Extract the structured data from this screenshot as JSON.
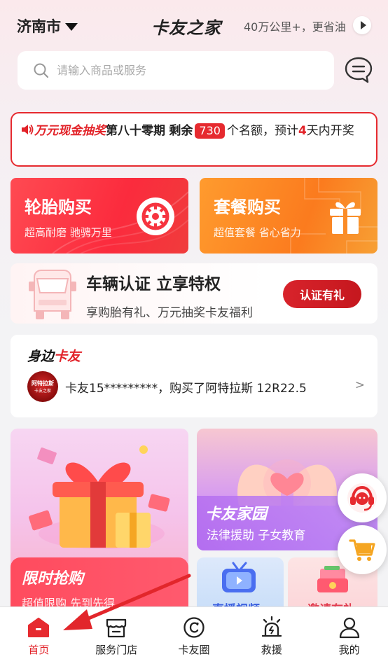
{
  "header": {
    "city": "济南市",
    "brand": "卡友之家",
    "slogan": "40万公里+，更省油"
  },
  "search": {
    "placeholder": "请输入商品或服务"
  },
  "notice": {
    "lottery_title": "万元现金抽奖",
    "period": "第八十零期",
    "remaining_label": "剩余",
    "count": "730",
    "text_mid": "个名额，预计",
    "days": "4",
    "text_end": "天内开奖"
  },
  "cards": {
    "tyre": {
      "title": "轮胎购买",
      "subtitle": "超高耐磨 驰骋万里"
    },
    "package": {
      "title": "套餐购买",
      "subtitle": "超值套餐 省心省力"
    },
    "cert": {
      "title": "车辆认证 立享特权",
      "subtitle": "享购胎有礼、万元抽奖卡友福利",
      "button": "认证有礼"
    }
  },
  "friends": {
    "title_prefix": "身边",
    "title_suffix": "卡友",
    "avatar_text": "阿特拉斯",
    "avatar_sub": "卡友之家",
    "message": "卡友15*********，购买了阿特拉斯 12R22.5",
    "arrow": ">"
  },
  "promos": {
    "flash": {
      "title": "限时抢购",
      "subtitle": "超值限购 先到先得"
    },
    "home": {
      "title": "卡友家园",
      "subtitle": "法律援助  子女教育"
    },
    "video": {
      "title": "直播视频"
    },
    "invite": {
      "title": "邀请有礼"
    }
  },
  "tabs": [
    {
      "label": "首页",
      "icon": "home-icon",
      "active": true
    },
    {
      "label": "服务门店",
      "icon": "store-icon",
      "active": false
    },
    {
      "label": "卡友圈",
      "icon": "circle-icon",
      "active": false
    },
    {
      "label": "救援",
      "icon": "rescue-icon",
      "active": false
    },
    {
      "label": "我的",
      "icon": "profile-icon",
      "active": false
    }
  ],
  "colors": {
    "accent": "#e62a2f",
    "orange": "#fb7b1e"
  }
}
